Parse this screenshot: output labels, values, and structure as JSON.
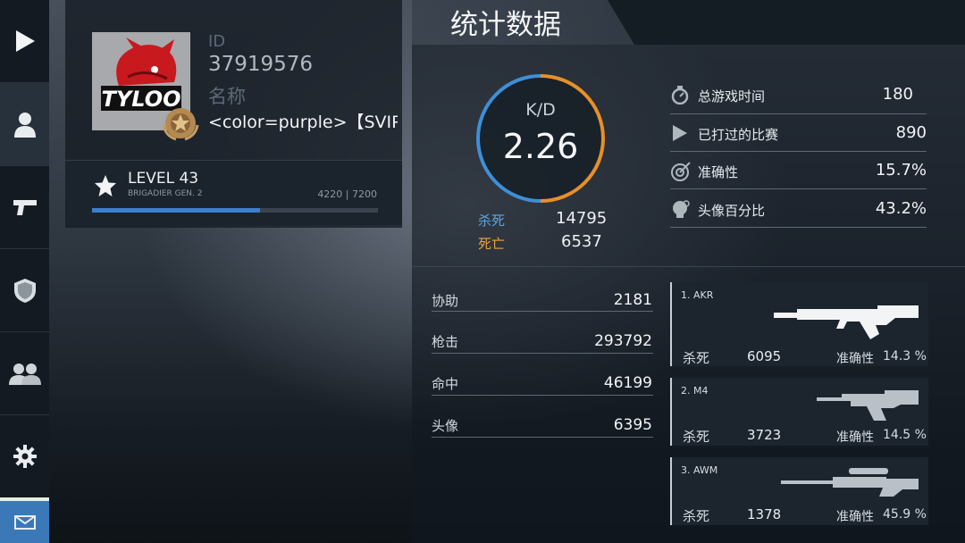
{
  "sidebar": {
    "items": [
      {
        "name": "play",
        "icon": "play-icon"
      },
      {
        "name": "profile",
        "icon": "user-icon",
        "active": true
      },
      {
        "name": "weapons",
        "icon": "pistol-icon"
      },
      {
        "name": "clan",
        "icon": "shield-icon"
      },
      {
        "name": "friends",
        "icon": "friends-icon"
      },
      {
        "name": "settings",
        "icon": "gear-icon"
      },
      {
        "name": "mail",
        "icon": "mail-icon"
      }
    ]
  },
  "profile": {
    "avatar_text": "TYLOO",
    "id_label": "ID",
    "id_value": "37919576",
    "name_label": "名称",
    "name_value": "<color=purple>【SVIP",
    "level": "LEVEL 43",
    "rank": "BRIGADIER GEN. 2",
    "xp": "4220 | 7200",
    "xp_fraction": 0.586
  },
  "stats": {
    "title": "统计数据",
    "kd_label": "K/D",
    "kd_value": "2.26",
    "kills_label": "杀死",
    "kills_value": "14795",
    "deaths_label": "死亡",
    "deaths_value": "6537",
    "right": [
      {
        "label": "总游戏时间",
        "value": "180",
        "icon": "stopwatch-icon"
      },
      {
        "label": "已打过的比赛",
        "value": "890",
        "icon": "play-icon"
      },
      {
        "label": "准确性",
        "value": "15.7%",
        "icon": "target-icon"
      },
      {
        "label": "头像百分比",
        "value": "43.2%",
        "icon": "head-icon"
      }
    ],
    "left": [
      {
        "label": "协助",
        "value": "2181"
      },
      {
        "label": "枪击",
        "value": "293792"
      },
      {
        "label": "命中",
        "value": "46199"
      },
      {
        "label": "头像",
        "value": "6395"
      }
    ]
  },
  "weapons": [
    {
      "label": "1. AKR",
      "kills_label": "杀死",
      "kills": "6095",
      "acc_label": "准确性",
      "acc": "14.3 %"
    },
    {
      "label": "2. M4",
      "kills_label": "杀死",
      "kills": "3723",
      "acc_label": "准确性",
      "acc": "14.5 %"
    },
    {
      "label": "3. AWM",
      "kills_label": "杀死",
      "kills": "1378",
      "acc_label": "准确性",
      "acc": "45.9 %"
    }
  ],
  "colors": {
    "kills": "#5aa7e6",
    "deaths": "#f0a040",
    "ring_blue": "#3e8fd6",
    "ring_orange": "#e88f2a",
    "xp_bar": "#3c7fcf"
  }
}
